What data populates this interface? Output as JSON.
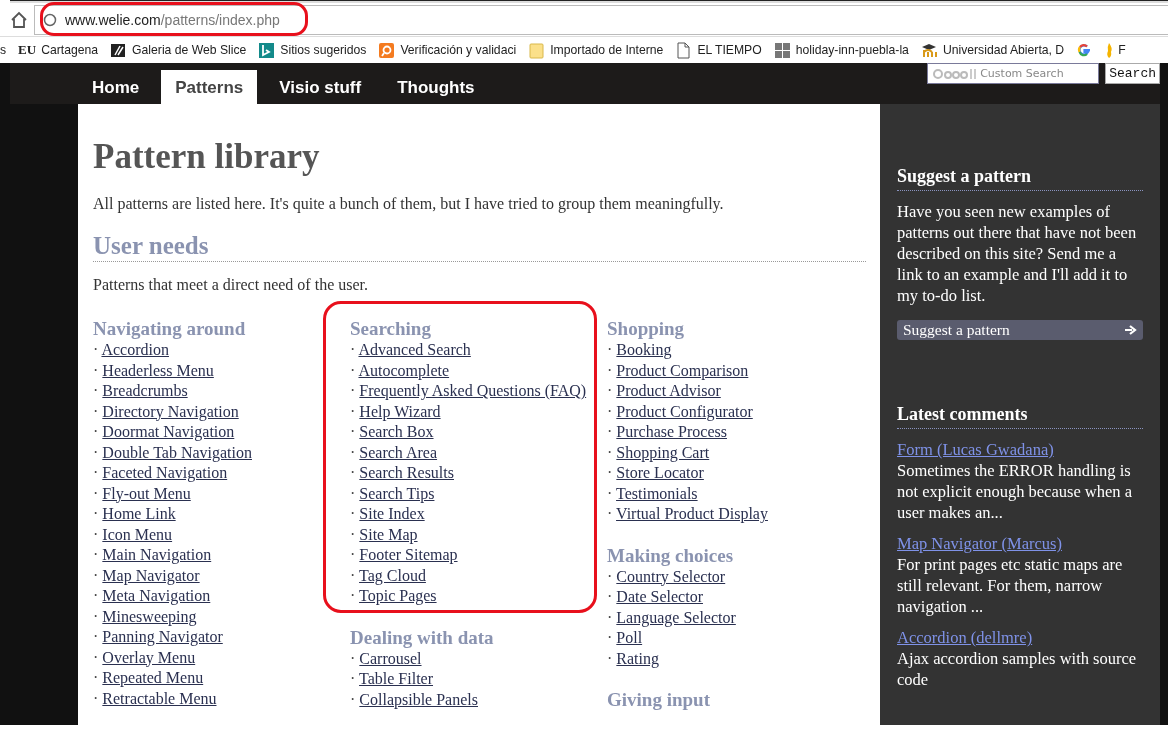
{
  "browser": {
    "address_bar": {
      "url_domain": "www.welie.com",
      "url_path": "/patterns/index.php",
      "highlighted": true
    },
    "bookmarks": [
      {
        "kind": "none",
        "label": "s"
      },
      {
        "kind": "eu",
        "badge": "EU",
        "label": "Cartagena"
      },
      {
        "kind": "slice",
        "label": "Galeria de Web Slice"
      },
      {
        "kind": "bing",
        "label": "Sitios sugeridos"
      },
      {
        "kind": "orange",
        "label": "Verificación y validaci"
      },
      {
        "kind": "folder",
        "label": "Importado de Interne"
      },
      {
        "kind": "page",
        "label": "EL TIEMPO"
      },
      {
        "kind": "grid",
        "label": "holiday-inn-puebla-la"
      },
      {
        "kind": "cap",
        "label": "Universidad Abierta, D"
      },
      {
        "kind": "google"
      },
      {
        "kind": "flame",
        "label": "F"
      }
    ]
  },
  "site": {
    "tabs": [
      {
        "label": "Home",
        "selected": false
      },
      {
        "label": "Patterns",
        "selected": true
      },
      {
        "label": "Visio stuff",
        "selected": false
      },
      {
        "label": "Thoughts",
        "selected": false
      }
    ],
    "search": {
      "placeholder": "Custom Search",
      "button": "Search"
    }
  },
  "main": {
    "title": "Pattern library",
    "intro": "All patterns are listed here. It's quite a bunch of them, but I have tried to group them meaningfully.",
    "section": {
      "title": "User needs",
      "description": "Patterns that meet a direct need of the user."
    },
    "bullet": "·",
    "columns": [
      {
        "groups": [
          {
            "title": "Navigating around",
            "highlighted": false,
            "items": [
              "Accordion",
              "Headerless Menu",
              "Breadcrumbs",
              "Directory Navigation",
              "Doormat Navigation",
              "Double Tab Navigation",
              "Faceted Navigation",
              "Fly-out Menu",
              "Home Link",
              "Icon Menu",
              "Main Navigation",
              "Map Navigator",
              "Meta Navigation",
              "Minesweeping",
              "Panning Navigator",
              "Overlay Menu",
              "Repeated Menu",
              "Retractable Menu"
            ]
          }
        ]
      },
      {
        "groups": [
          {
            "title": "Searching",
            "highlighted": true,
            "items": [
              "Advanced Search",
              "Autocomplete",
              "Frequently Asked Questions (FAQ)",
              "Help Wizard",
              "Search Box",
              "Search Area",
              "Search Results",
              "Search Tips",
              "Site Index",
              "Site Map",
              "Footer Sitemap",
              "Tag Cloud",
              "Topic Pages"
            ]
          },
          {
            "title": "Dealing with data",
            "highlighted": false,
            "items": [
              "Carrousel",
              "Table Filter",
              "Collapsible Panels"
            ]
          }
        ]
      },
      {
        "groups": [
          {
            "title": "Shopping",
            "highlighted": false,
            "items": [
              "Booking",
              "Product Comparison",
              "Product Advisor",
              "Product Configurator",
              "Purchase Process",
              "Shopping Cart",
              "Store Locator",
              "Testimonials",
              "Virtual Product Display"
            ]
          },
          {
            "title": "Making choices",
            "highlighted": false,
            "items": [
              "Country Selector",
              "Date Selector",
              "Language Selector",
              "Poll",
              "Rating"
            ]
          },
          {
            "title": "Giving input",
            "highlighted": false
          }
        ]
      }
    ]
  },
  "sidebar": {
    "suggest": {
      "title": "Suggest a pattern",
      "text": "Have you seen new examples of patterns out there that have not been described on this site? Send me a link to an example and I'll add it to my to-do list.",
      "button": "Suggest a pattern"
    },
    "comments": {
      "title": "Latest comments",
      "items": [
        {
          "link": "Form (Lucas Gwadana)",
          "text": "Sometimes the ERROR handling is not explicit enough because when a user makes an..."
        },
        {
          "link": "Map Navigator (Marcus)",
          "text": "For print pages etc static maps are still relevant. For them, narrow navigation ..."
        },
        {
          "link": "Accordion (dellmre)",
          "text": "Ajax accordion samples with source code"
        }
      ]
    }
  }
}
